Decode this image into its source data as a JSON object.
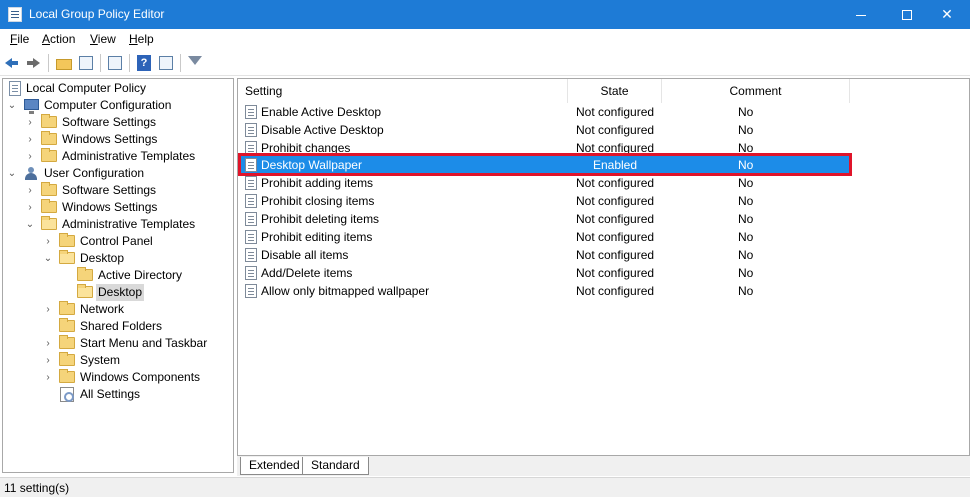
{
  "window": {
    "title": "Local Group Policy Editor",
    "accent_color": "#1e7bd6",
    "controls": {
      "minimize": "minimize-icon",
      "maximize": "maximize-icon",
      "close": "✕"
    }
  },
  "menu": [
    "File",
    "Action",
    "View",
    "Help"
  ],
  "toolbar": {
    "icons": [
      "back-arrow-icon",
      "forward-arrow-icon",
      "up-folder-icon",
      "show-hide-tree-icon",
      "export-list-icon",
      "help-icon",
      "properties-icon",
      "filter-icon"
    ]
  },
  "tree": {
    "root": "Local Computer Policy",
    "computer_configuration": "Computer Configuration",
    "cc_software_settings": "Software Settings",
    "cc_windows_settings": "Windows Settings",
    "cc_admin_templates": "Administrative Templates",
    "user_configuration": "User Configuration",
    "uc_software_settings": "Software Settings",
    "uc_windows_settings": "Windows Settings",
    "uc_admin_templates": "Administrative Templates",
    "control_panel": "Control Panel",
    "desktop": "Desktop",
    "active_directory": "Active Directory",
    "desktop_sub": "Desktop",
    "network": "Network",
    "shared_folders": "Shared Folders",
    "start_menu": "Start Menu and Taskbar",
    "system": "System",
    "windows_components": "Windows Components",
    "all_settings": "All Settings"
  },
  "list": {
    "headers": {
      "setting": "Setting",
      "state": "State",
      "comment": "Comment"
    },
    "rows": [
      {
        "name": "Enable Active Desktop",
        "state": "Not configured",
        "comment": "No"
      },
      {
        "name": "Disable Active Desktop",
        "state": "Not configured",
        "comment": "No"
      },
      {
        "name": "Prohibit changes",
        "state": "Not configured",
        "comment": "No"
      },
      {
        "name": "Desktop Wallpaper",
        "state": "Enabled",
        "comment": "No"
      },
      {
        "name": "Prohibit adding items",
        "state": "Not configured",
        "comment": "No"
      },
      {
        "name": "Prohibit closing items",
        "state": "Not configured",
        "comment": "No"
      },
      {
        "name": "Prohibit deleting items",
        "state": "Not configured",
        "comment": "No"
      },
      {
        "name": "Prohibit editing items",
        "state": "Not configured",
        "comment": "No"
      },
      {
        "name": "Disable all items",
        "state": "Not configured",
        "comment": "No"
      },
      {
        "name": "Add/Delete items",
        "state": "Not configured",
        "comment": "No"
      },
      {
        "name": "Allow only bitmapped wallpaper",
        "state": "Not configured",
        "comment": "No"
      }
    ],
    "selected_color": "#1c8ce8",
    "highlight_border_color": "#e0142a"
  },
  "tabs": {
    "extended": "Extended",
    "standard": "Standard"
  },
  "status": {
    "text": "11 setting(s)"
  }
}
